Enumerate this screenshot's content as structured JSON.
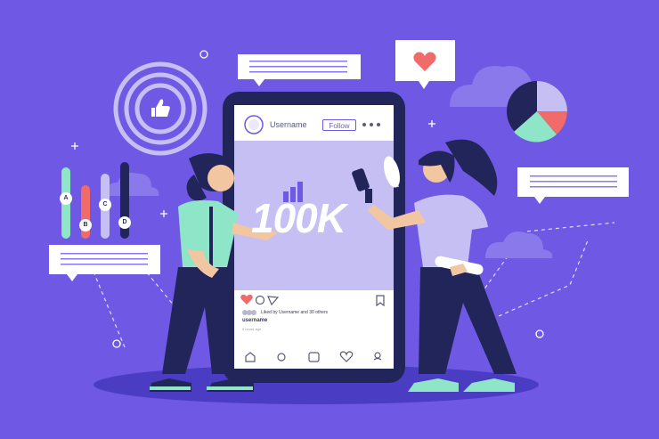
{
  "post": {
    "username": "Username",
    "follow_label": "Follow",
    "more_icon": "more-dots-icon",
    "image_text": "100K",
    "liked_by": "Liked by Username and 30 others",
    "caption_username": "username",
    "time_ago": "5 hours ago"
  },
  "bar_chart_labels": [
    "A",
    "B",
    "C",
    "D"
  ],
  "colors": {
    "background": "#6f58e3",
    "accent_purple": "#c5bff3",
    "dark_navy": "#22255a",
    "teal": "#8ee5c8",
    "coral": "#f26b6b",
    "white": "#ffffff"
  },
  "icons": [
    "like-target-icon",
    "heart-icon",
    "pie-chart-icon",
    "megaphone-icon",
    "home-icon",
    "search-icon",
    "plus-icon",
    "heart-outline-icon",
    "profile-icon",
    "comment-icon",
    "share-icon",
    "bookmark-icon"
  ]
}
